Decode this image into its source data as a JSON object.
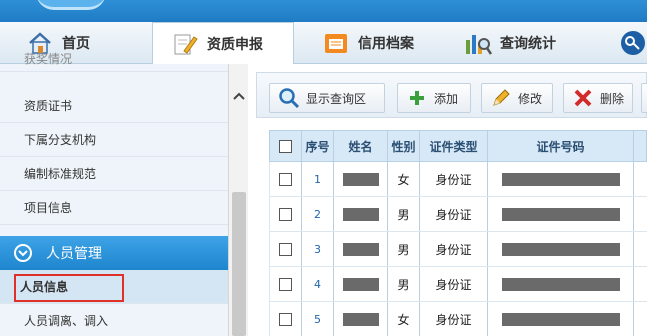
{
  "nav": {
    "tabs": [
      {
        "label": "首页",
        "icon": "home-icon"
      },
      {
        "label": "资质申报",
        "icon": "edit-pencil-icon"
      },
      {
        "label": "信用档案",
        "icon": "folder-icon"
      },
      {
        "label": "查询统计",
        "icon": "chart-search-icon"
      },
      {
        "label": "",
        "icon": "key-icon"
      }
    ]
  },
  "sidebar": {
    "items": [
      {
        "label": "获奖情况"
      },
      {
        "label": "资质证书"
      },
      {
        "label": "下属分支机构"
      },
      {
        "label": "编制标准规范"
      },
      {
        "label": "项目信息"
      }
    ],
    "section": {
      "label": "人员管理"
    },
    "sub_items": [
      {
        "label": "人员信息"
      },
      {
        "label": "人员调离、调入"
      }
    ]
  },
  "toolbar": {
    "buttons": [
      {
        "label": "显示查询区",
        "icon": "search-icon"
      },
      {
        "label": "添加",
        "icon": "plus-icon"
      },
      {
        "label": "修改",
        "icon": "pencil-icon"
      },
      {
        "label": "删除",
        "icon": "delete-x-icon"
      }
    ]
  },
  "grid": {
    "headers": [
      "序号",
      "姓名",
      "性别",
      "证件类型",
      "证件号码"
    ],
    "rows": [
      {
        "index": "1",
        "gender": "女",
        "id_type": "身份证"
      },
      {
        "index": "2",
        "gender": "男",
        "id_type": "身份证"
      },
      {
        "index": "3",
        "gender": "男",
        "id_type": "身份证"
      },
      {
        "index": "4",
        "gender": "男",
        "id_type": "身份证"
      },
      {
        "index": "5",
        "gender": "女",
        "id_type": "身份证"
      }
    ]
  },
  "colors": {
    "accent": "#1e86cf",
    "highlight_border": "#e0302a"
  }
}
